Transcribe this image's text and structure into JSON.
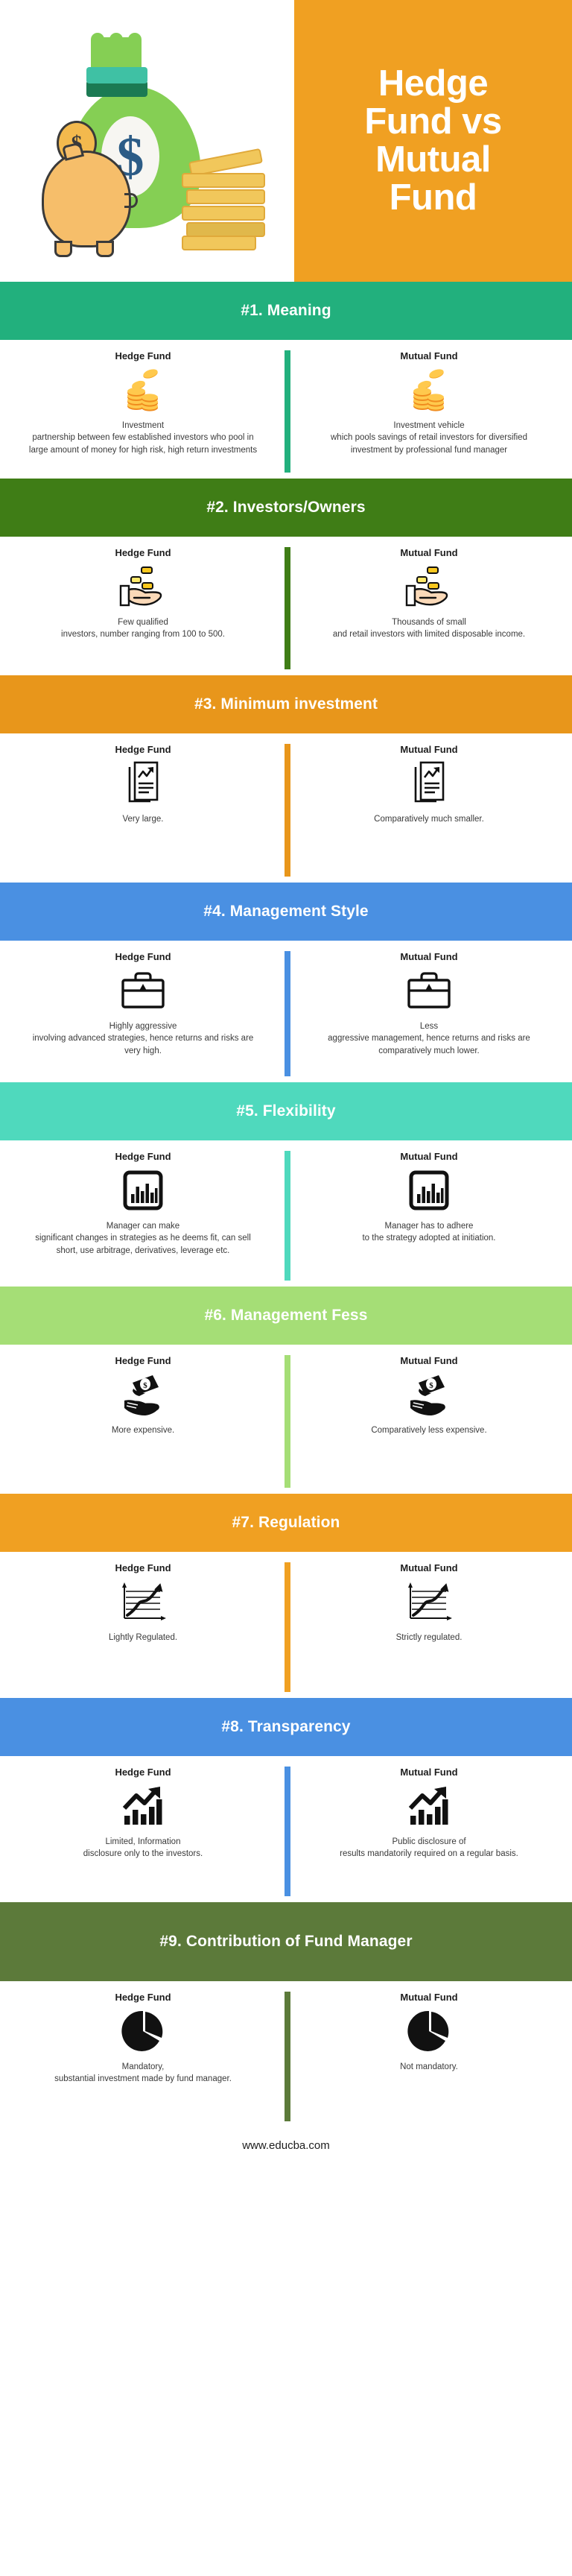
{
  "header": {
    "title_line1": "Hedge",
    "title_line2": "Fund vs",
    "title_line3": "Mutual",
    "title_line4": "Fund",
    "background_color": "#F0A022",
    "illustration": "money-bag-piggy-bank-coins"
  },
  "labels": {
    "hedge_fund": "Hedge Fund",
    "mutual_fund": "Mutual Fund"
  },
  "sections": [
    {
      "id": "meaning",
      "band_title": "#1. Meaning",
      "band_color": "#22B07D",
      "hedge_icon": "coin-stack-icon",
      "mutual_icon": "coin-stack-icon",
      "hedge_text": "Investment\npartnership between few established investors who pool in large amount of money for high risk, high return investments",
      "mutual_text": "Investment vehicle\nwhich pools savings of retail investors for diversified investment by professional fund manager"
    },
    {
      "id": "investors-owners",
      "band_title": "#2. Investors/Owners",
      "band_color": "#3F7D16",
      "hedge_icon": "hand-with-coins-icon",
      "mutual_icon": "hand-with-coins-icon",
      "hedge_text": "Few qualified\ninvestors, number ranging from 100 to 500.",
      "mutual_text": "Thousands of small\nand retail investors with limited disposable income."
    },
    {
      "id": "minimum-investment",
      "band_title": "#3. Minimum investment",
      "band_color": "#E8961B",
      "hedge_icon": "document-chart-icon",
      "mutual_icon": "document-chart-icon",
      "hedge_text": "Very large.",
      "mutual_text": "Comparatively much smaller."
    },
    {
      "id": "management-style",
      "band_title": "#4. Management Style",
      "band_color": "#4A90E2",
      "hedge_icon": "briefcase-icon",
      "mutual_icon": "briefcase-icon",
      "hedge_text": "Highly aggressive\ninvolving advanced strategies, hence returns and risks are very high.",
      "mutual_text": "Less\naggressive management, hence returns and risks are comparatively much lower."
    },
    {
      "id": "flexibility",
      "band_title": "#5. Flexibility",
      "band_color": "#4FD9BD",
      "hedge_icon": "bar-chart-box-icon",
      "mutual_icon": "bar-chart-box-icon",
      "hedge_text": "Manager can make\nsignificant changes in strategies as he deems fit, can sell short, use arbitrage, derivatives, leverage etc.",
      "mutual_text": "Manager has to adhere\nto the strategy adopted at initiation."
    },
    {
      "id": "management-fess",
      "band_title": "#6. Management Fess",
      "band_color": "#A5DE76",
      "hedge_icon": "hand-with-banknote-icon",
      "mutual_icon": "hand-with-banknote-icon",
      "hedge_text": "More expensive.",
      "mutual_text": "Comparatively less expensive."
    },
    {
      "id": "regulation",
      "band_title": "#7. Regulation",
      "band_color": "#F0A022",
      "hedge_icon": "line-graph-arrow-icon",
      "mutual_icon": "line-graph-arrow-icon",
      "hedge_text": "Lightly Regulated.",
      "mutual_text": "Strictly regulated."
    },
    {
      "id": "transparency",
      "band_title": "#8. Transparency",
      "band_color": "#4A90E2",
      "hedge_icon": "growth-bar-arrow-icon",
      "mutual_icon": "growth-bar-arrow-icon",
      "hedge_text": "Limited, Information\ndisclosure only to the investors.",
      "mutual_text": "Public disclosure of\nresults mandatorily required on a regular basis."
    },
    {
      "id": "contribution-of-fund-manager",
      "band_title": "#9. Contribution of Fund Manager",
      "band_color": "#5C7A3A",
      "hedge_icon": "pie-chart-icon",
      "mutual_icon": "pie-chart-icon",
      "hedge_text": "Mandatory,\nsubstantial investment made by fund manager.",
      "mutual_text": "Not mandatory."
    }
  ],
  "footer": {
    "url": "www.educba.com"
  }
}
